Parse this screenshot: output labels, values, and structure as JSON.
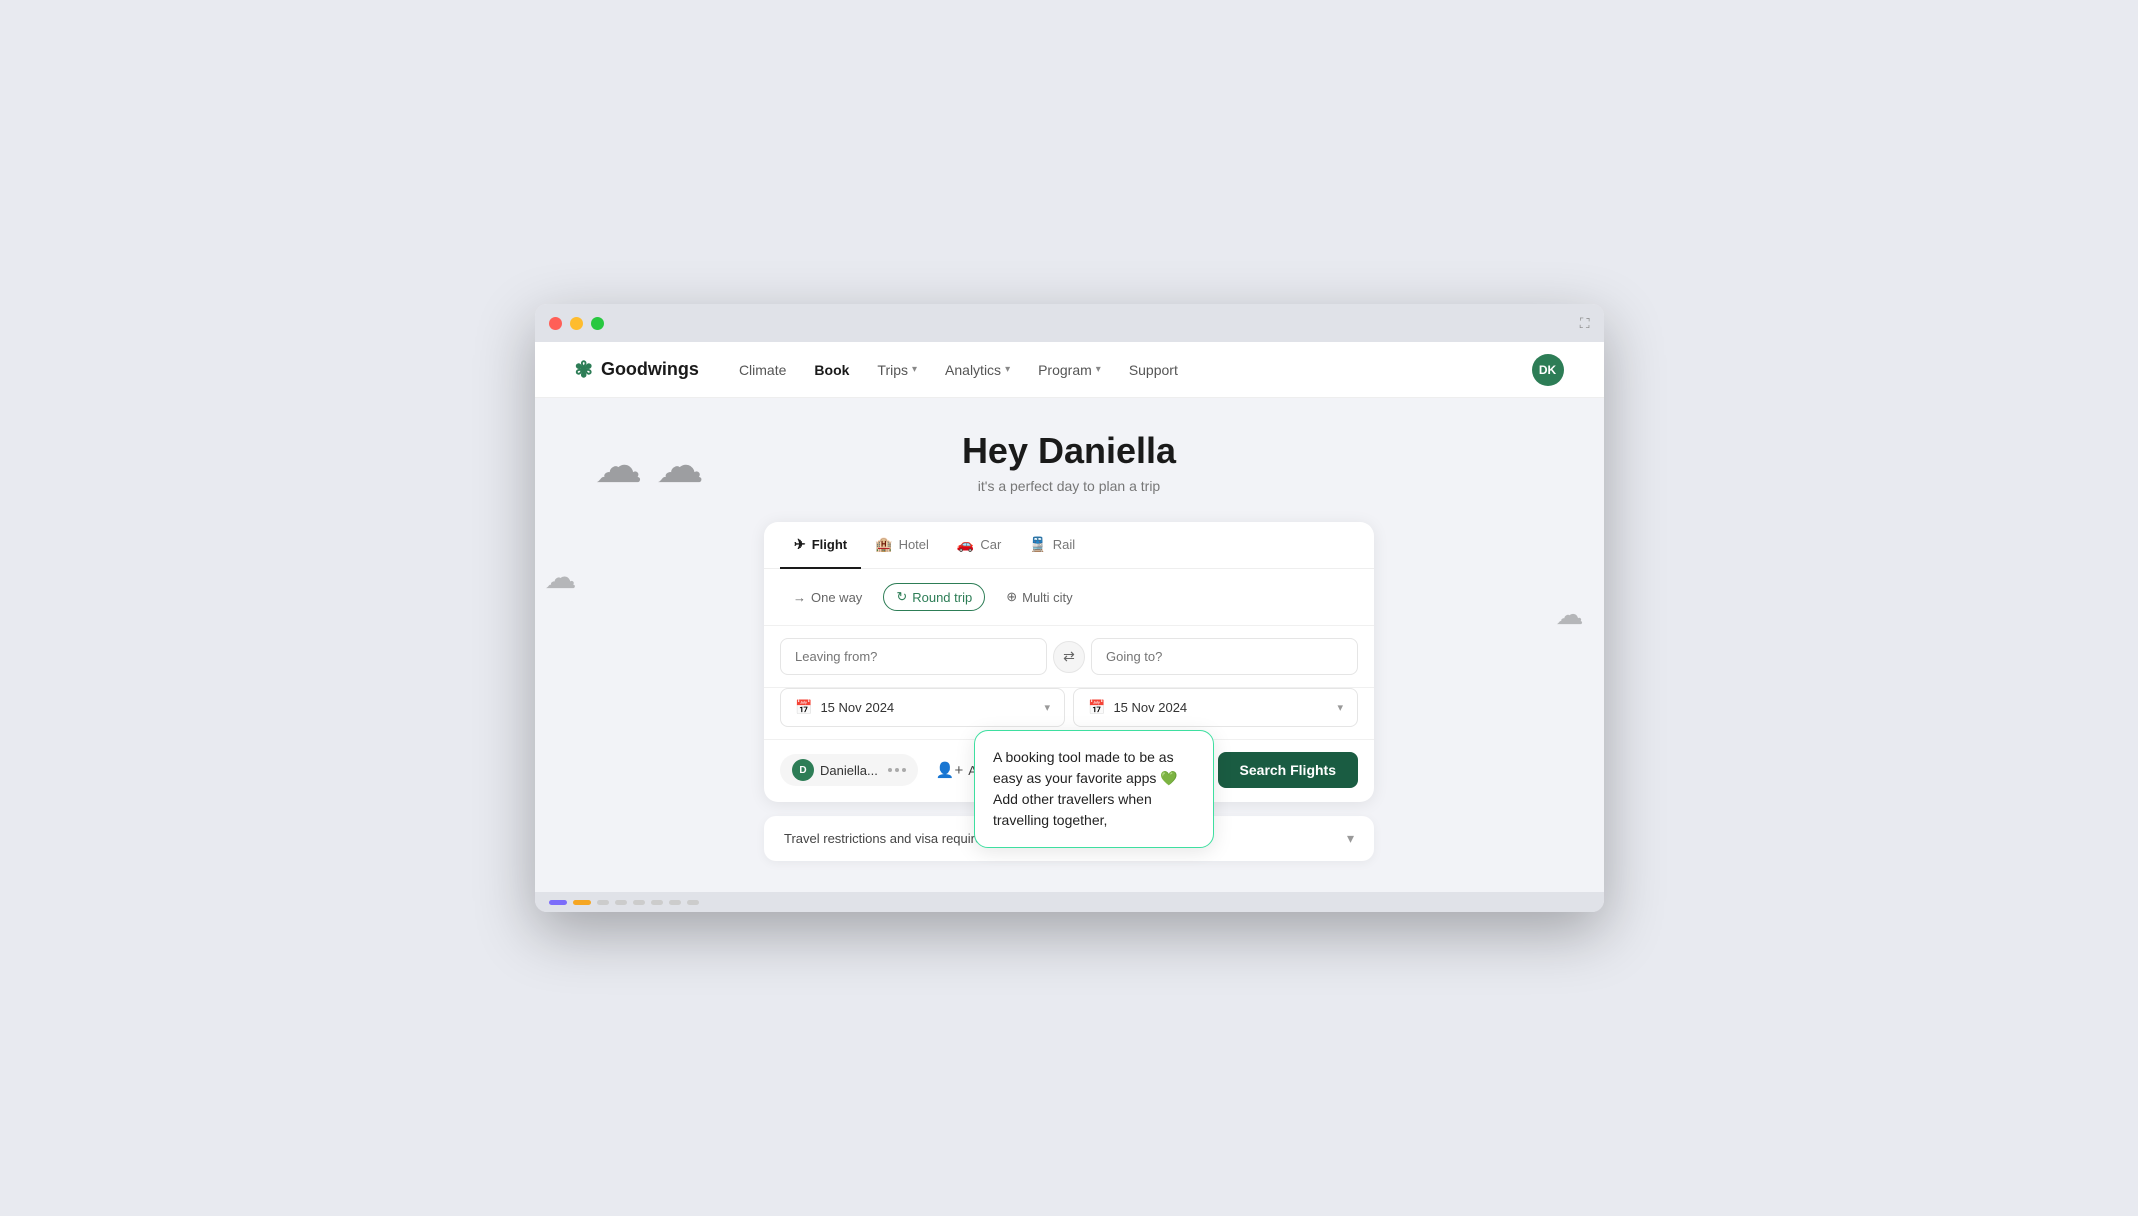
{
  "titlebar": {
    "expand_label": "⛶"
  },
  "navbar": {
    "logo_text": "Goodwings",
    "logo_icon": "✿",
    "links": [
      {
        "label": "Climate",
        "active": false,
        "has_dropdown": false
      },
      {
        "label": "Book",
        "active": true,
        "has_dropdown": false
      },
      {
        "label": "Trips",
        "active": false,
        "has_dropdown": true
      },
      {
        "label": "Analytics",
        "active": false,
        "has_dropdown": true
      },
      {
        "label": "Program",
        "active": false,
        "has_dropdown": true
      },
      {
        "label": "Support",
        "active": false,
        "has_dropdown": false
      }
    ],
    "avatar_initials": "DK"
  },
  "hero": {
    "title": "Hey Daniella",
    "subtitle": "it's a perfect day to plan a trip"
  },
  "search_card": {
    "tabs": [
      {
        "label": "Flight",
        "icon": "✈",
        "active": true
      },
      {
        "label": "Hotel",
        "icon": "🏨",
        "active": false
      },
      {
        "label": "Car",
        "icon": "🚗",
        "active": false
      },
      {
        "label": "Rail",
        "icon": "🚆",
        "active": false
      }
    ],
    "trip_types": [
      {
        "label": "One way",
        "icon": "→",
        "active": false
      },
      {
        "label": "Round trip",
        "icon": "↻",
        "active": true
      },
      {
        "label": "Multi city",
        "icon": "⊕",
        "active": false
      }
    ],
    "leaving_from_placeholder": "Leaving from?",
    "going_to_placeholder": "Going to?",
    "date_depart": "15 Nov 2024",
    "date_return": "15 Nov 2024",
    "traveller_name": "Daniella...",
    "add_traveller_label": "Add traveller",
    "search_button_label": "Search Flights",
    "tooltip_text": "A booking tool made to be as easy as your favorite apps 💚 Add other travellers when travelling together,"
  },
  "restrictions": {
    "label": "Travel restrictions and visa requirements"
  },
  "bottom": {
    "dots": [
      "purple",
      "amber",
      "gray",
      "gray",
      "gray",
      "gray",
      "gray",
      "gray",
      "gray",
      "gray"
    ]
  }
}
